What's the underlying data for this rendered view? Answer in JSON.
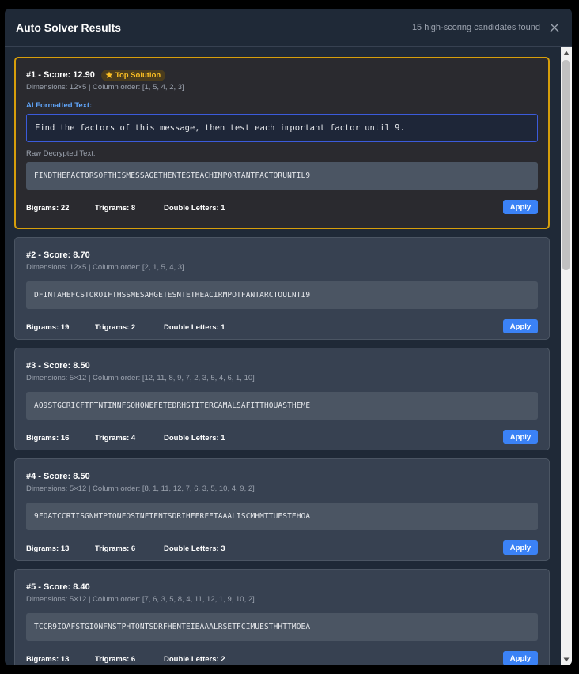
{
  "header": {
    "title": "Auto Solver Results",
    "count_text": "15 high-scoring candidates found"
  },
  "labels": {
    "top_badge": "Top Solution",
    "ai_formatted": "AI Formatted Text:",
    "raw_decrypted": "Raw Decrypted Text:",
    "apply": "Apply"
  },
  "results": [
    {
      "title": "#1 - Score: 12.90",
      "meta": "Dimensions: 12×5 | Column order: [1, 5, 4, 2, 3]",
      "ai_text": "Find the factors of this message, then test each important factor until 9.",
      "text": "FINDTHEFACTORSOFTHISMESSAGETHENTESTEACHIMPORTANTFACTORUNTIL9",
      "bigrams": "Bigrams: 22",
      "trigrams": "Trigrams: 8",
      "doubles": "Double Letters: 1"
    },
    {
      "title": "#2 - Score: 8.70",
      "meta": "Dimensions: 12×5 | Column order: [2, 1, 5, 4, 3]",
      "text": "DFINTAHEFCSTOROIFTHSSMESAHGETESNTETHEACIRMPOTFANTARCTOULNTI9",
      "bigrams": "Bigrams: 19",
      "trigrams": "Trigrams: 2",
      "doubles": "Double Letters: 1"
    },
    {
      "title": "#3 - Score: 8.50",
      "meta": "Dimensions: 5×12 | Column order: [12, 11, 8, 9, 7, 2, 3, 5, 4, 6, 1, 10]",
      "text": "AO9STGCRICFTPTNTINNFSOHONEFETEDRHSTITERCAMALSAFITTHOUASTHEME",
      "bigrams": "Bigrams: 16",
      "trigrams": "Trigrams: 4",
      "doubles": "Double Letters: 1"
    },
    {
      "title": "#4 - Score: 8.50",
      "meta": "Dimensions: 5×12 | Column order: [8, 1, 11, 12, 7, 6, 3, 5, 10, 4, 9, 2]",
      "text": "9FOATCCRTISGNHTPIONFOSTNFTENTSDRIHEERFETAAALISCMHMTTUESTEHOA",
      "bigrams": "Bigrams: 13",
      "trigrams": "Trigrams: 6",
      "doubles": "Double Letters: 3"
    },
    {
      "title": "#5 - Score: 8.40",
      "meta": "Dimensions: 5×12 | Column order: [7, 6, 3, 5, 8, 4, 11, 12, 1, 9, 10, 2]",
      "text": "TCCR9IOAFSTGIONFNSTPHTONTSDRFHENTEIEAAALRSETFCIMUESTHHTTMOEA",
      "bigrams": "Bigrams: 13",
      "trigrams": "Trigrams: 6",
      "doubles": "Double Letters: 2"
    }
  ],
  "colors": {
    "modal_bg": "#1f2937",
    "card_bg": "#374151",
    "top_border": "#d69e0b",
    "accent": "#3b82f6",
    "ai_label": "#60a5fa"
  }
}
